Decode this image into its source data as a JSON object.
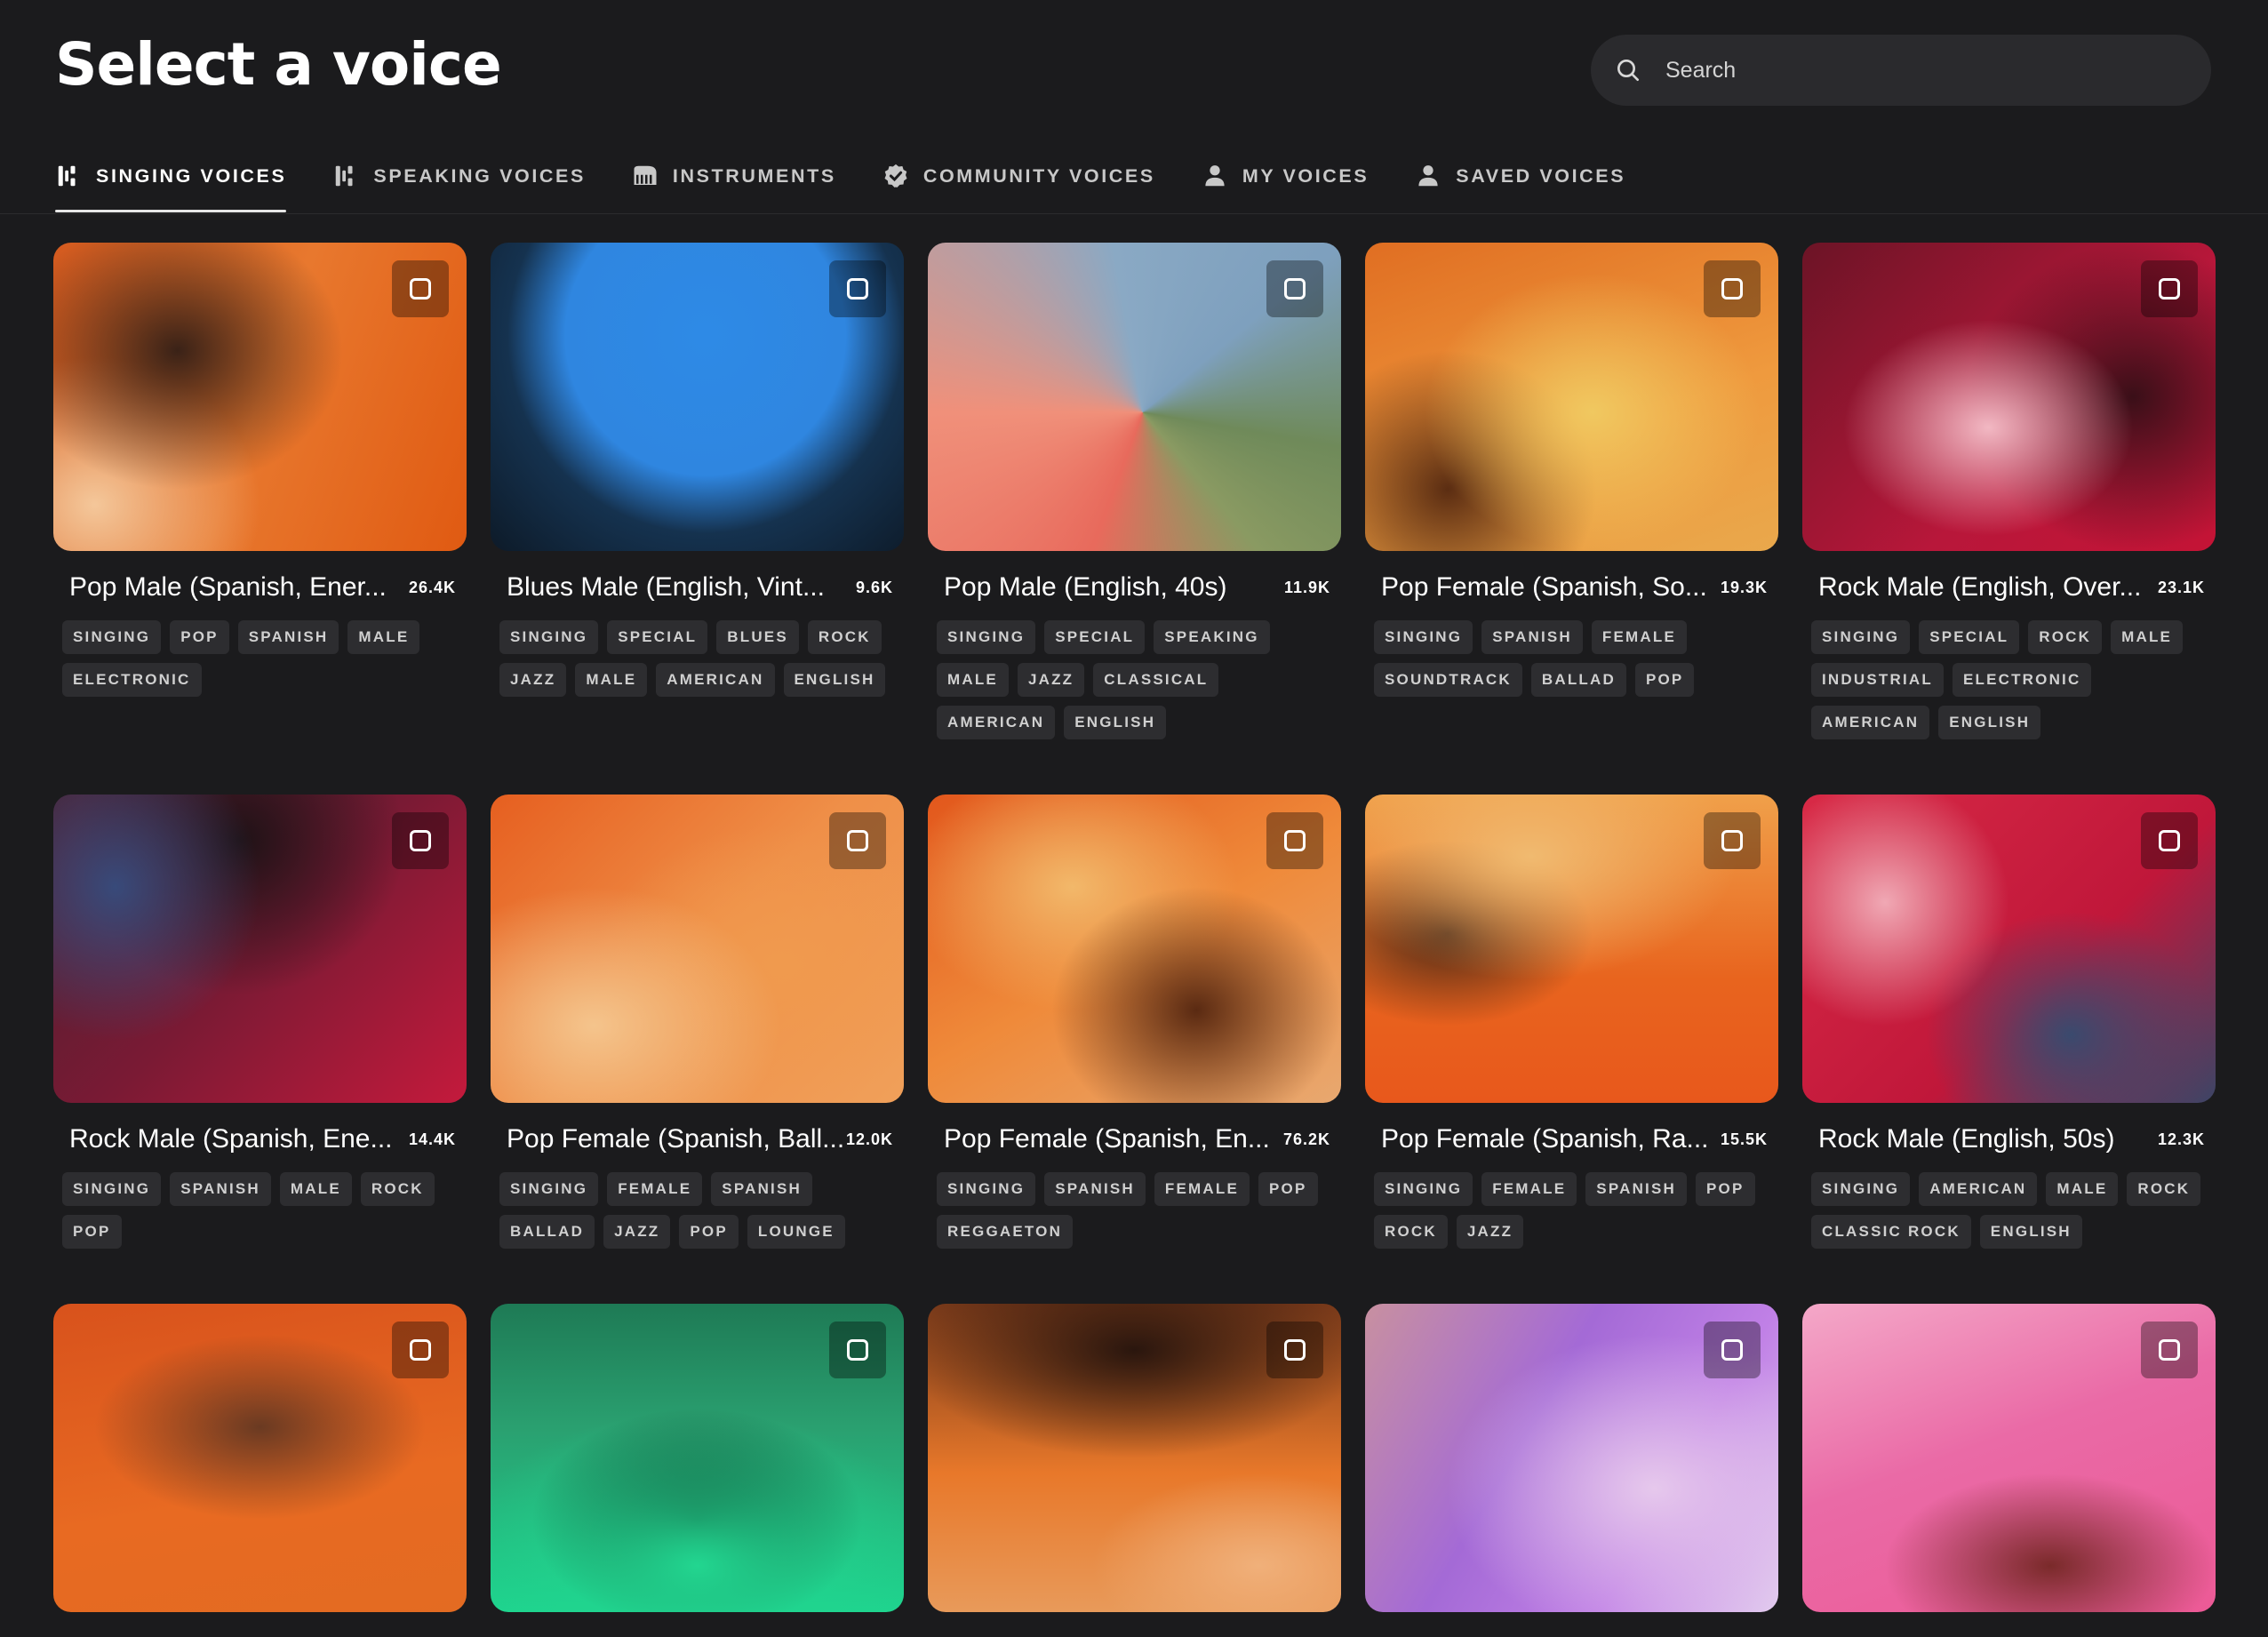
{
  "header": {
    "title": "Select a voice"
  },
  "search": {
    "placeholder": "Search"
  },
  "tabs": [
    {
      "label": "SINGING VOICES",
      "icon": "voice-waves-icon",
      "active": true
    },
    {
      "label": "SPEAKING VOICES",
      "icon": "voice-waves-icon",
      "active": false
    },
    {
      "label": "INSTRUMENTS",
      "icon": "piano-icon",
      "active": false
    },
    {
      "label": "COMMUNITY VOICES",
      "icon": "verified-badge-icon",
      "active": false
    },
    {
      "label": "MY VOICES",
      "icon": "person-icon",
      "active": false
    },
    {
      "label": "SAVED VOICES",
      "icon": "person-icon",
      "active": false
    }
  ],
  "voices": [
    {
      "title": "Pop Male (Spanish, Ener...",
      "count": "26.4K",
      "tags": [
        "SINGING",
        "POP",
        "SPANISH",
        "MALE",
        "ELECTRONIC"
      ]
    },
    {
      "title": "Blues Male (English, Vint...",
      "count": "9.6K",
      "tags": [
        "SINGING",
        "SPECIAL",
        "BLUES",
        "ROCK",
        "JAZZ",
        "MALE",
        "AMERICAN",
        "ENGLISH"
      ]
    },
    {
      "title": "Pop Male (English, 40s)",
      "count": "11.9K",
      "tags": [
        "SINGING",
        "SPECIAL",
        "SPEAKING",
        "MALE",
        "JAZZ",
        "CLASSICAL",
        "AMERICAN",
        "ENGLISH"
      ]
    },
    {
      "title": "Pop Female (Spanish, So...",
      "count": "19.3K",
      "tags": [
        "SINGING",
        "SPANISH",
        "FEMALE",
        "SOUNDTRACK",
        "BALLAD",
        "POP"
      ]
    },
    {
      "title": "Rock Male (English, Over...",
      "count": "23.1K",
      "tags": [
        "SINGING",
        "SPECIAL",
        "ROCK",
        "MALE",
        "INDUSTRIAL",
        "ELECTRONIC",
        "AMERICAN",
        "ENGLISH"
      ]
    },
    {
      "title": "Rock Male (Spanish, Ene...",
      "count": "14.4K",
      "tags": [
        "SINGING",
        "SPANISH",
        "MALE",
        "ROCK",
        "POP"
      ]
    },
    {
      "title": "Pop Female (Spanish, Ball...",
      "count": "12.0K",
      "tags": [
        "SINGING",
        "FEMALE",
        "SPANISH",
        "BALLAD",
        "JAZZ",
        "POP",
        "LOUNGE"
      ]
    },
    {
      "title": "Pop Female (Spanish, En...",
      "count": "76.2K",
      "tags": [
        "SINGING",
        "SPANISH",
        "FEMALE",
        "POP",
        "REGGAETON"
      ]
    },
    {
      "title": "Pop Female (Spanish, Ra...",
      "count": "15.5K",
      "tags": [
        "SINGING",
        "FEMALE",
        "SPANISH",
        "POP",
        "ROCK",
        "JAZZ"
      ]
    },
    {
      "title": "Rock Male (English, 50s)",
      "count": "12.3K",
      "tags": [
        "SINGING",
        "AMERICAN",
        "MALE",
        "ROCK",
        "CLASSIC ROCK",
        "ENGLISH"
      ]
    },
    {
      "title": "",
      "count": "",
      "tags": []
    },
    {
      "title": "",
      "count": "",
      "tags": []
    },
    {
      "title": "",
      "count": "",
      "tags": []
    },
    {
      "title": "",
      "count": "",
      "tags": []
    },
    {
      "title": "",
      "count": "",
      "tags": []
    }
  ]
}
